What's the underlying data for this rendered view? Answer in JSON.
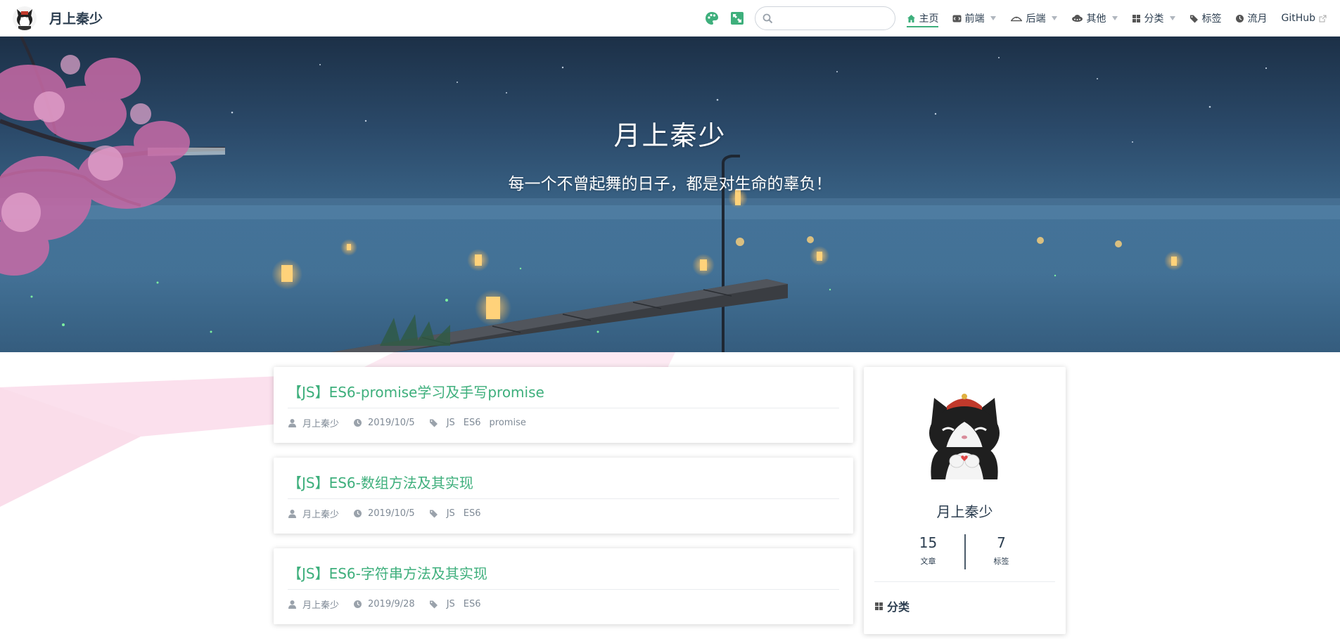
{
  "site": {
    "title": "月上秦少"
  },
  "navbar": {
    "search_placeholder": "",
    "items": [
      {
        "label": "主页",
        "icon": "home-icon",
        "active": true,
        "dropdown": false
      },
      {
        "label": "前端",
        "icon": "code-icon",
        "active": false,
        "dropdown": true
      },
      {
        "label": "后端",
        "icon": "server-hat-icon",
        "active": false,
        "dropdown": true
      },
      {
        "label": "其他",
        "icon": "alien-icon",
        "active": false,
        "dropdown": true
      },
      {
        "label": "分类",
        "icon": "grid-icon",
        "active": false,
        "dropdown": true
      },
      {
        "label": "标签",
        "icon": "tag-icon",
        "active": false,
        "dropdown": false
      },
      {
        "label": "流月",
        "icon": "clock-icon",
        "active": false,
        "dropdown": false
      },
      {
        "label": "GitHub",
        "icon": "external-link-icon",
        "active": false,
        "dropdown": false
      }
    ]
  },
  "hero": {
    "title": "月上秦少",
    "subtitle": "每一个不曾起舞的日子，都是对生命的辜负！"
  },
  "posts": [
    {
      "title": "【JS】ES6-promise学习及手写promise",
      "author": "月上秦少",
      "date": "2019/10/5",
      "tags": [
        "JS",
        "ES6",
        "promise"
      ]
    },
    {
      "title": "【JS】ES6-数组方法及其实现",
      "author": "月上秦少",
      "date": "2019/10/5",
      "tags": [
        "JS",
        "ES6"
      ]
    },
    {
      "title": "【JS】ES6-字符串方法及其实现",
      "author": "月上秦少",
      "date": "2019/9/28",
      "tags": [
        "JS",
        "ES6"
      ]
    }
  ],
  "sidebar": {
    "name": "月上秦少",
    "stats": [
      {
        "value": "15",
        "label": "文章"
      },
      {
        "value": "7",
        "label": "标签"
      }
    ],
    "section_title": "分类"
  },
  "colors": {
    "accent": "#3eaf7c",
    "text": "#2c3e50",
    "meta": "#7f8a96"
  }
}
